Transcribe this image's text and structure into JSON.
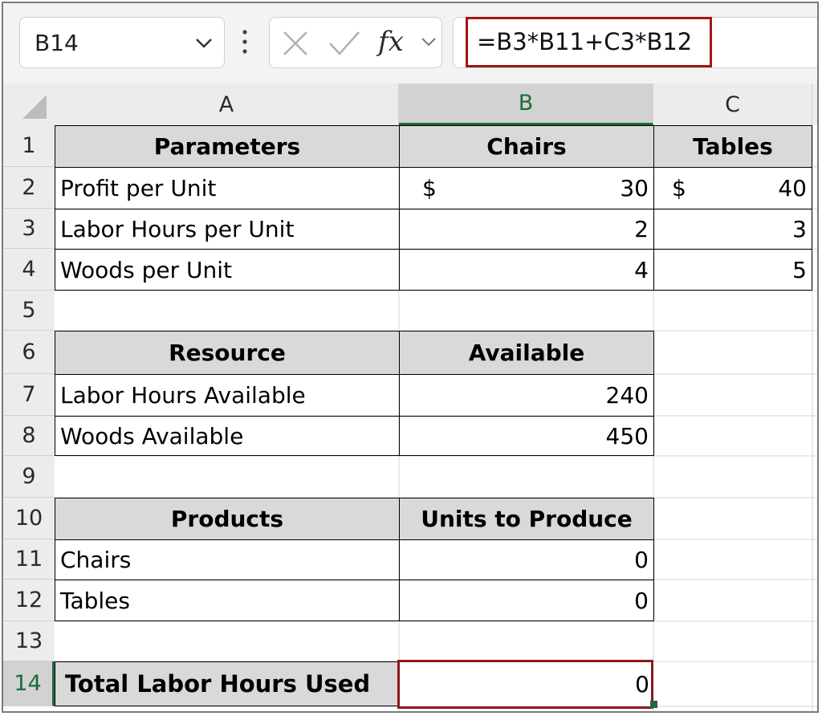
{
  "formula_bar": {
    "name_box": "B14",
    "fx_label": "fx",
    "formula": "=B3*B11+C3*B12"
  },
  "columns": [
    {
      "label": "A"
    },
    {
      "label": "B"
    },
    {
      "label": "C"
    }
  ],
  "rows": [
    "1",
    "2",
    "3",
    "4",
    "5",
    "6",
    "7",
    "8",
    "9",
    "10",
    "11",
    "12",
    "13",
    "14"
  ],
  "cells": {
    "A1": "Parameters",
    "B1": "Chairs",
    "C1": "Tables",
    "A2": "Profit per Unit",
    "B2_sym": "$",
    "B2": "30",
    "C2_sym": "$",
    "C2": "40",
    "A3": "Labor Hours per Unit",
    "B3": "2",
    "C3": "3",
    "A4": "Woods per Unit",
    "B4": "4",
    "C4": "5",
    "A6": "Resource",
    "B6": "Available",
    "A7": "Labor Hours Available",
    "B7": "240",
    "A8": "Woods Available",
    "B8": "450",
    "A10": "Products",
    "B10": "Units to Produce",
    "A11": "Chairs",
    "B11": "0",
    "A12": "Tables",
    "B12": "0",
    "A14": "Total Labor Hours Used",
    "B14": "0"
  },
  "colors": {
    "header_fill": "#d9d9d9",
    "accent_green": "#1e6b3a",
    "highlight_red": "#a31515"
  }
}
